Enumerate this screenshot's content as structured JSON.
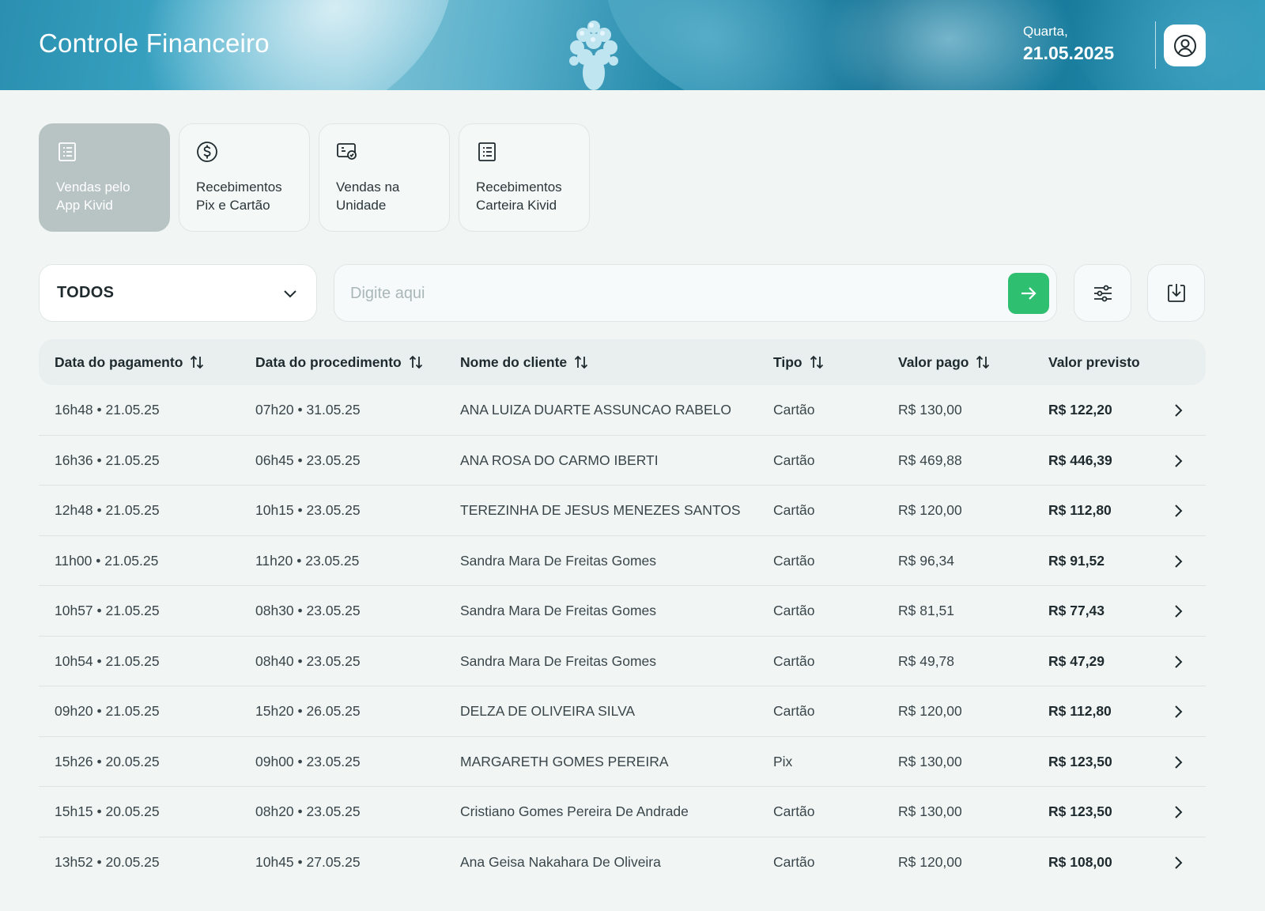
{
  "header": {
    "title": "Controle Financeiro",
    "weekday": "Quarta,",
    "date": "21.05.2025"
  },
  "cards": [
    {
      "label_line1": "Vendas pelo",
      "label_line2": "App Kivid",
      "icon": "receipt-icon",
      "active": true
    },
    {
      "label_line1": "Recebimentos",
      "label_line2": "Pix e Cartão",
      "icon": "dollar-circle-icon",
      "active": false
    },
    {
      "label_line1": "Vendas na",
      "label_line2": "Unidade",
      "icon": "storefront-icon",
      "active": false
    },
    {
      "label_line1": "Recebimentos",
      "label_line2": "Carteira Kivid",
      "icon": "wallet-receipt-icon",
      "active": false
    }
  ],
  "filters": {
    "select_value": "TODOS",
    "search_placeholder": "Digite aqui"
  },
  "colors": {
    "accent_green": "#2fbf71",
    "active_card": "#b8c4c3",
    "header_blue": "#1f86a7"
  },
  "table": {
    "columns": [
      "Data do pagamento",
      "Data do procedimento",
      "Nome do cliente",
      "Tipo",
      "Valor pago",
      "Valor previsto"
    ],
    "rows": [
      [
        "16h48 • 21.05.25",
        "07h20 • 31.05.25",
        "ANA LUIZA DUARTE ASSUNCAO RABELO",
        "Cartão",
        "R$ 130,00",
        "R$ 122,20"
      ],
      [
        "16h36 • 21.05.25",
        "06h45 • 23.05.25",
        "ANA ROSA DO CARMO IBERTI",
        "Cartão",
        "R$ 469,88",
        "R$ 446,39"
      ],
      [
        "12h48 • 21.05.25",
        "10h15 • 23.05.25",
        "TEREZINHA DE JESUS MENEZES SANTOS",
        "Cartão",
        "R$ 120,00",
        "R$ 112,80"
      ],
      [
        "11h00 • 21.05.25",
        "11h20 • 23.05.25",
        "Sandra Mara De Freitas Gomes",
        "Cartão",
        "R$ 96,34",
        "R$ 91,52"
      ],
      [
        "10h57 • 21.05.25",
        "08h30 • 23.05.25",
        "Sandra Mara De Freitas Gomes",
        "Cartão",
        "R$ 81,51",
        "R$ 77,43"
      ],
      [
        "10h54 • 21.05.25",
        "08h40 • 23.05.25",
        "Sandra Mara De Freitas Gomes",
        "Cartão",
        "R$ 49,78",
        "R$ 47,29"
      ],
      [
        "09h20 • 21.05.25",
        "15h20 • 26.05.25",
        "DELZA DE OLIVEIRA SILVA",
        "Cartão",
        "R$ 120,00",
        "R$ 112,80"
      ],
      [
        "15h26 • 20.05.25",
        "09h00 • 23.05.25",
        "MARGARETH GOMES PEREIRA",
        "Pix",
        "R$ 130,00",
        "R$ 123,50"
      ],
      [
        "15h15 • 20.05.25",
        "08h20 • 23.05.25",
        "Cristiano Gomes Pereira De Andrade",
        "Cartão",
        "R$ 130,00",
        "R$ 123,50"
      ],
      [
        "13h52 • 20.05.25",
        "10h45 • 27.05.25",
        "Ana Geisa Nakahara De Oliveira",
        "Cartão",
        "R$ 120,00",
        "R$ 108,00"
      ]
    ]
  }
}
